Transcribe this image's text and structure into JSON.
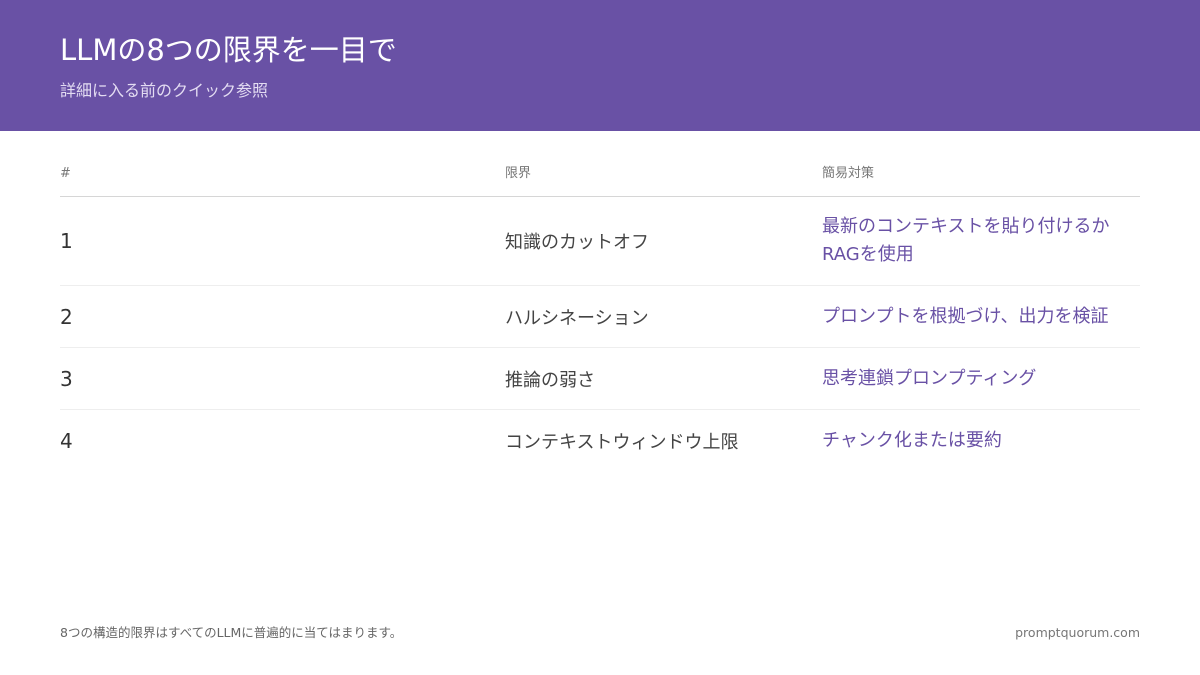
{
  "header": {
    "title": "LLMの8つの限界を一目で",
    "subtitle": "詳細に入る前のクイック参照"
  },
  "table": {
    "columns": [
      "#",
      "限界",
      "簡易対策"
    ],
    "rows": [
      {
        "num": "1",
        "limit": "知識のカットオフ",
        "fix": "最新のコンテキストを貼り付けるかRAGを使用"
      },
      {
        "num": "2",
        "limit": "ハルシネーション",
        "fix": "プロンプトを根拠づけ、出力を検証"
      },
      {
        "num": "3",
        "limit": "推論の弱さ",
        "fix": "思考連鎖プロンプティング"
      },
      {
        "num": "4",
        "limit": "コンテキストウィンドウ上限",
        "fix": "チャンク化または要約"
      }
    ]
  },
  "footer": {
    "note": "8つの構造的限界はすべてのLLMに普遍的に当てはまります。",
    "brand": "promptquorum.com"
  }
}
